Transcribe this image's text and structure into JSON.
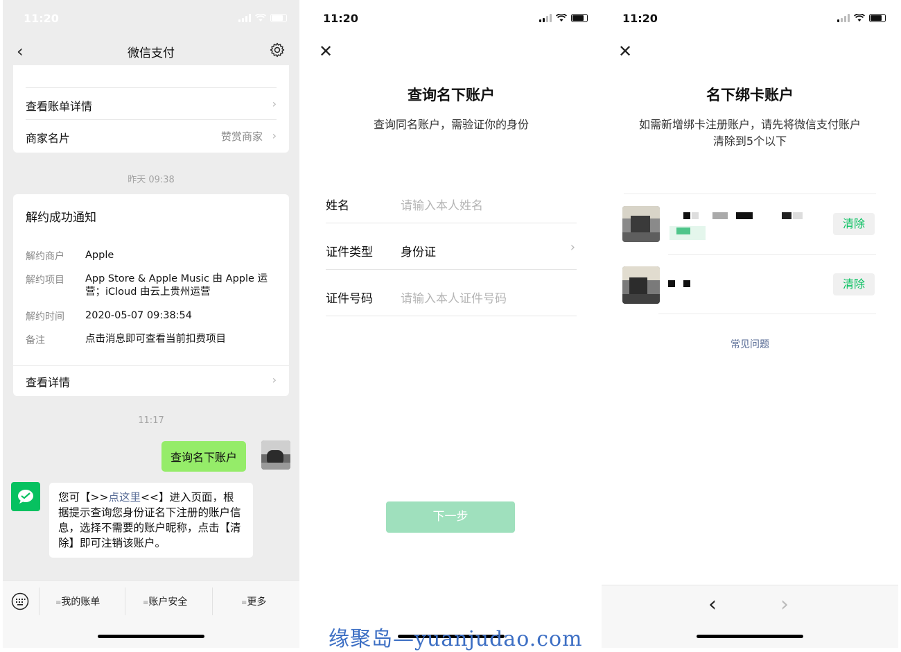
{
  "status": {
    "time": "11:20"
  },
  "chat": {
    "nav_title": "微信支付",
    "card1": {
      "view_bill_label": "查看账单详情",
      "merchant_label": "商家名片",
      "merchant_value": "赞赏商家"
    },
    "timestamp1": "昨天 09:38",
    "notice": {
      "title": "解约成功通知",
      "rows": [
        {
          "key": "解约商户",
          "value": "Apple"
        },
        {
          "key": "解约项目",
          "value": "App Store & Apple Music 由 Apple 运营；iCloud 由云上贵州运营"
        },
        {
          "key": "解约时间",
          "value": "2020-05-07 09:38:54"
        },
        {
          "key": "备注",
          "value": "点击消息即可查看当前扣费项目"
        }
      ],
      "detail_label": "查看详情"
    },
    "timestamp2": "11:17",
    "sent_message": "查询名下账户",
    "reply": {
      "pre": "您可【>>",
      "link": "点这里",
      "post": "<<】进入页面，根据提示查询您身份证名下注册的账户信息，选择不需要的账户昵称，点击【清除】即可注销该账户。"
    },
    "toolbar": {
      "bill": "我的账单",
      "security": "账户安全",
      "more": "更多"
    }
  },
  "query": {
    "title": "查询名下账户",
    "subtitle": "查询同名账户，需验证你的身份",
    "fields": [
      {
        "label": "姓名",
        "placeholder": "请输入本人姓名"
      },
      {
        "label": "证件类型",
        "value": "身份证"
      },
      {
        "label": "证件号码",
        "placeholder": "请输入本人证件号码"
      }
    ],
    "next_label": "下一步"
  },
  "accounts": {
    "title": "名下绑卡账户",
    "subtitle_line1": "如需新增绑卡注册账户，请先将微信支付账户",
    "subtitle_line2": "清除到5个以下",
    "clear_label": "清除",
    "faq_label": "常见问题"
  },
  "watermark": "缘聚岛—yuanjudao.com",
  "colors": {
    "wechat_green": "#07c160",
    "bubble_green": "#95ec69",
    "link_blue": "#576b95"
  }
}
